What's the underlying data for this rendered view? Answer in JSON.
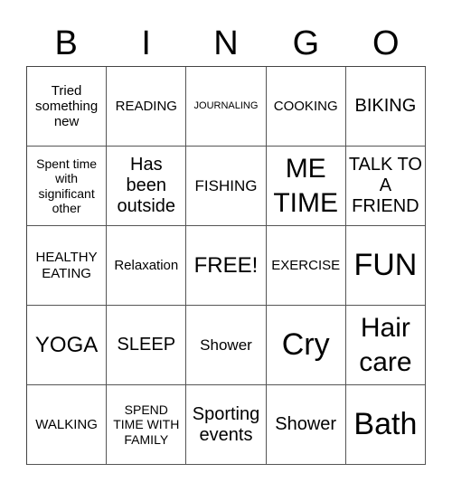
{
  "header": {
    "letters": [
      "B",
      "I",
      "N",
      "G",
      "O"
    ]
  },
  "board": {
    "rows": [
      [
        {
          "text": "Tried something new",
          "size": "m"
        },
        {
          "text": "READING",
          "size": "m"
        },
        {
          "text": "JOURNALING",
          "size": "xs"
        },
        {
          "text": "COOKING",
          "size": "m"
        },
        {
          "text": "BIKING",
          "size": "l"
        }
      ],
      [
        {
          "text": "Spent time with significant other",
          "size": "s"
        },
        {
          "text": "Has been outside",
          "size": "l"
        },
        {
          "text": "FISHING",
          "size": "ml"
        },
        {
          "text": "ME TIME",
          "size": "xxl"
        },
        {
          "text": "TALK TO A FRIEND",
          "size": "l"
        }
      ],
      [
        {
          "text": "HEALTHY EATING",
          "size": "m"
        },
        {
          "text": "Relaxation",
          "size": "m"
        },
        {
          "text": "FREE!",
          "size": "xl"
        },
        {
          "text": "EXERCISE",
          "size": "m"
        },
        {
          "text": "FUN",
          "size": "xxxl"
        }
      ],
      [
        {
          "text": "YOGA",
          "size": "xl"
        },
        {
          "text": "SLEEP",
          "size": "l"
        },
        {
          "text": "Shower",
          "size": "ml"
        },
        {
          "text": "Cry",
          "size": "xxxl"
        },
        {
          "text": "Hair care",
          "size": "xxl"
        }
      ],
      [
        {
          "text": "WALKING",
          "size": "m"
        },
        {
          "text": "SPEND TIME WITH FAMILY",
          "size": "s"
        },
        {
          "text": "Sporting events",
          "size": "l"
        },
        {
          "text": "Shower",
          "size": "l"
        },
        {
          "text": "Bath",
          "size": "xxxl"
        }
      ]
    ]
  }
}
